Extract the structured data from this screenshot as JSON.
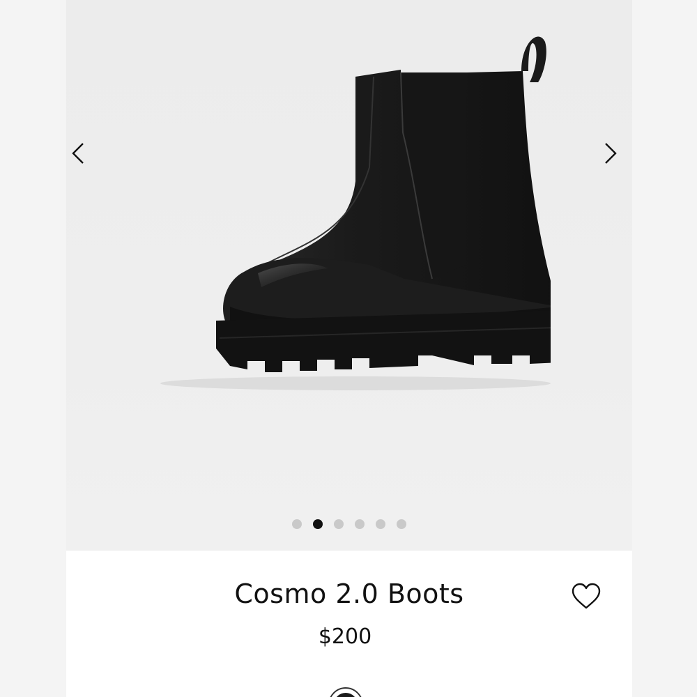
{
  "product": {
    "title": "Cosmo 2.0 Boots",
    "price": "$200"
  },
  "gallery": {
    "image_count": 6,
    "active_index": 1,
    "prev_icon": "chevron-left-icon",
    "next_icon": "chevron-right-icon"
  },
  "actions": {
    "favorite_icon": "heart-outline-icon"
  },
  "colors": {
    "accent": "#111111",
    "dot_inactive": "#c9c9c9",
    "swatch": "#1a1a1a"
  }
}
